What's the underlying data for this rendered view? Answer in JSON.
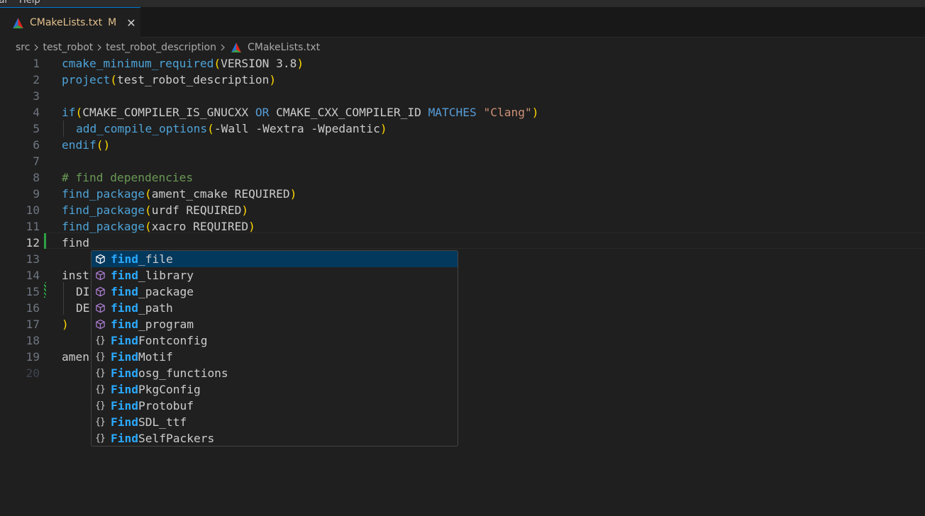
{
  "menubar": {
    "items": [
      "ral",
      "Help"
    ]
  },
  "tab": {
    "filename": "CMakeLists.txt",
    "status": "M",
    "close": "✕"
  },
  "breadcrumb": {
    "items": [
      "src",
      "test_robot",
      "test_robot_description"
    ],
    "file": "CMakeLists.txt"
  },
  "editor": {
    "line_numbers": [
      "1",
      "2",
      "3",
      "4",
      "5",
      "6",
      "7",
      "8",
      "9",
      "10",
      "11",
      "12",
      "13",
      "14",
      "15",
      "16",
      "17",
      "18",
      "19",
      "20"
    ],
    "active_line": "12",
    "l1": {
      "fn": "cmake_minimum_required",
      "p1": "(",
      "args": "VERSION 3.8",
      "p2": ")"
    },
    "l2": {
      "fn": "project",
      "p1": "(",
      "args": "test_robot_description",
      "p2": ")"
    },
    "l4": {
      "fn": "if",
      "p1": "(",
      "a1": "CMAKE_COMPILER_IS_GNUCXX ",
      "op1": "OR",
      "a2": " CMAKE_CXX_COMPILER_ID ",
      "op2": "MATCHES",
      "sp": " ",
      "str": "\"Clang\"",
      "p2": ")"
    },
    "l5": {
      "fn": "add_compile_options",
      "p1": "(",
      "args": "-Wall -Wextra -Wpedantic",
      "p2": ")"
    },
    "l6": {
      "fn": "endif",
      "p": "()"
    },
    "l8": {
      "comment": "# find dependencies"
    },
    "l9": {
      "fn": "find_package",
      "p1": "(",
      "args": "ament_cmake REQUIRED",
      "p2": ")"
    },
    "l10": {
      "fn": "find_package",
      "p1": "(",
      "args": "urdf REQUIRED",
      "p2": ")"
    },
    "l11": {
      "fn": "find_package",
      "p1": "(",
      "args": "xacro REQUIRED",
      "p2": ")"
    },
    "l12": {
      "text": "find"
    },
    "l14": {
      "text": "inst"
    },
    "l15": {
      "text": "DI"
    },
    "l16": {
      "text": "DE"
    },
    "l17": {
      "p": ")"
    },
    "l19": {
      "text": "amen"
    }
  },
  "suggest": {
    "items": [
      {
        "match": "find",
        "rest": "_file",
        "kind": "cube"
      },
      {
        "match": "find",
        "rest": "_library",
        "kind": "cube"
      },
      {
        "match": "find",
        "rest": "_package",
        "kind": "cube"
      },
      {
        "match": "find",
        "rest": "_path",
        "kind": "cube"
      },
      {
        "match": "find",
        "rest": "_program",
        "kind": "cube"
      },
      {
        "match": "Find",
        "rest": "Fontconfig",
        "kind": "braces"
      },
      {
        "match": "Find",
        "rest": "Motif",
        "kind": "braces"
      },
      {
        "match": "Find",
        "rest": "osg_functions",
        "kind": "braces"
      },
      {
        "match": "Find",
        "rest": "PkgConfig",
        "kind": "braces"
      },
      {
        "match": "Find",
        "rest": "Protobuf",
        "kind": "braces"
      },
      {
        "match": "Find",
        "rest": "SDL_ttf",
        "kind": "braces"
      },
      {
        "match": "Find",
        "rest": "SelfPackers",
        "kind": "braces"
      }
    ],
    "braces_glyph": "{}",
    "selected_index": 0
  },
  "colors": {
    "background": "#1f1f1f",
    "accent": "#0078d4",
    "modified": "#e2c08d",
    "match_highlight": "#2aaaff",
    "selection": "#04395e"
  }
}
